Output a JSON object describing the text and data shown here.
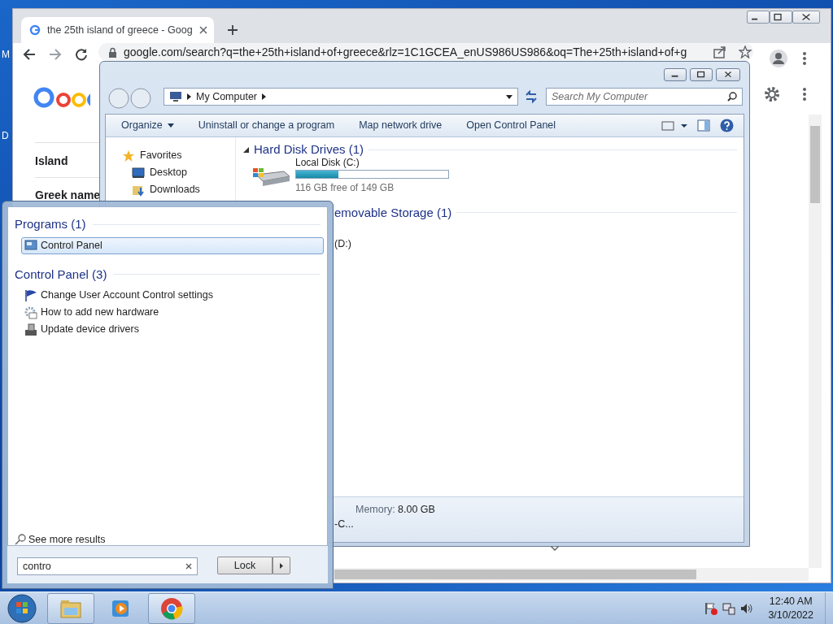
{
  "desktop": {
    "icon_labels": [
      "M",
      "D"
    ]
  },
  "browser": {
    "tab": {
      "title": "the 25th island of greece - Goog",
      "selected": true
    },
    "address": "google.com/search?q=the+25th+island+of+greece&rlz=1C1GCEA_enUS986US986&oq=The+25th+island+of+g",
    "rows": [
      "Island",
      "Greek name"
    ]
  },
  "explorer": {
    "address": "My Computer",
    "search_placeholder": "Search My Computer",
    "toolbar": [
      {
        "label": "Organize",
        "dropdown": true
      },
      {
        "label": "Uninstall or change a program",
        "dropdown": false
      },
      {
        "label": "Map network drive",
        "dropdown": false
      },
      {
        "label": "Open Control Panel",
        "dropdown": false
      }
    ],
    "nav": [
      {
        "label": "Favorites",
        "kind": "favorites"
      },
      {
        "label": "Desktop",
        "kind": "desktop"
      },
      {
        "label": "Downloads",
        "kind": "downloads"
      }
    ],
    "groups": [
      {
        "title": "Hard Disk Drives (1)",
        "kind": "full",
        "drives": [
          {
            "name": "Local Disk (C:)",
            "level": 0.28,
            "free": "116 GB free of 149 GB",
            "kind": "disk"
          }
        ]
      },
      {
        "title": "emovable Storage (1)",
        "kind": "partial",
        "drives": [
          {
            "name": "(D:)",
            "kind": "partial"
          }
        ]
      }
    ],
    "details": {
      "fragment": "-C...",
      "memory_label": "Memory:",
      "memory_value": "8.00 GB"
    }
  },
  "start_menu": {
    "sections": [
      {
        "title": "Programs (1)",
        "items": [
          {
            "label": "Control Panel",
            "selected": true
          }
        ]
      },
      {
        "title": "Control Panel (3)",
        "items": [
          {
            "label": "Change User Account Control settings",
            "selected": false
          },
          {
            "label": "How to add new hardware",
            "selected": false
          },
          {
            "label": "Update device drivers",
            "selected": false
          }
        ]
      }
    ],
    "see_more": "See more results",
    "search": "contro",
    "lock": "Lock"
  },
  "taskbar": {
    "apps": [
      {
        "kind": "folder",
        "selected": true
      },
      {
        "kind": "media",
        "selected": false
      },
      {
        "kind": "chrome",
        "selected": true
      }
    ],
    "time": "12:40 AM",
    "date": "3/10/2022"
  }
}
